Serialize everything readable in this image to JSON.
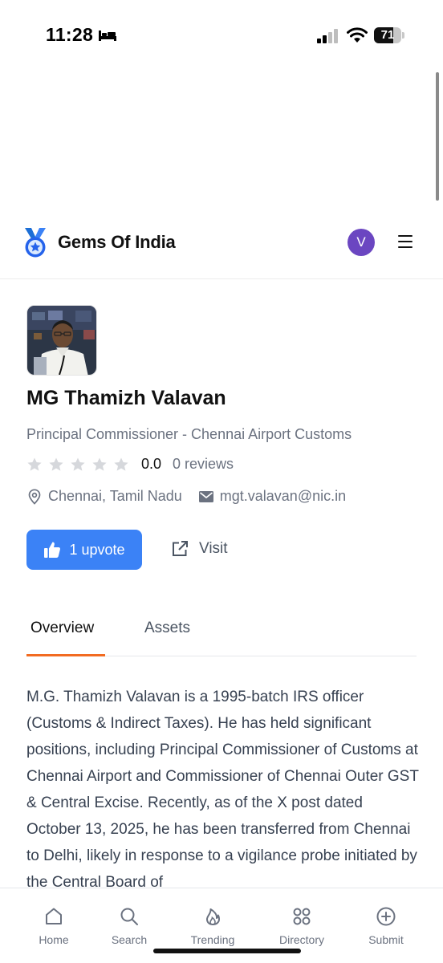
{
  "status_bar": {
    "time": "11:28",
    "battery_level": "71",
    "battery_fraction": 0.71
  },
  "header": {
    "brand_name": "Gems Of India",
    "avatar_initial": "V",
    "icons": {
      "logo": "medal-star-icon",
      "menu": "hamburger-menu-icon"
    }
  },
  "profile": {
    "name": "MG Thamizh Valavan",
    "title": "Principal Commissioner - Chennai Airport Customs",
    "rating_value": "0.0",
    "rating_stars_filled": 0,
    "rating_stars_total": 5,
    "reviews": "0 reviews",
    "location": "Chennai, Tamil Nadu",
    "email": "mgt.valavan@nic.in",
    "upvote_label": "1 upvote",
    "visit_label": "Visit"
  },
  "tabs": [
    {
      "label": "Overview",
      "active": true
    },
    {
      "label": "Assets",
      "active": false
    }
  ],
  "overview": {
    "text": "M.G. Thamizh Valavan is a 1995-batch IRS officer (Customs & Indirect Taxes). He has held significant positions, including Principal Commissioner of Customs at Chennai Airport and Commissioner of Chennai Outer GST & Central Excise. Recently, as of the X post dated October 13, 2025, he has been transferred from Chennai to Delhi, likely in response to a vigilance probe initiated by the Central Board of"
  },
  "bottom_nav": [
    {
      "label": "Home",
      "icon": "home-icon"
    },
    {
      "label": "Search",
      "icon": "search-icon"
    },
    {
      "label": "Trending",
      "icon": "flame-icon"
    },
    {
      "label": "Directory",
      "icon": "grid-icon"
    },
    {
      "label": "Submit",
      "icon": "plus-circle-icon"
    }
  ],
  "colors": {
    "accent_blue": "#3b82f6",
    "tab_underline": "#f26b21",
    "avatar": "#6b46c1",
    "muted_text": "#6b7280"
  }
}
